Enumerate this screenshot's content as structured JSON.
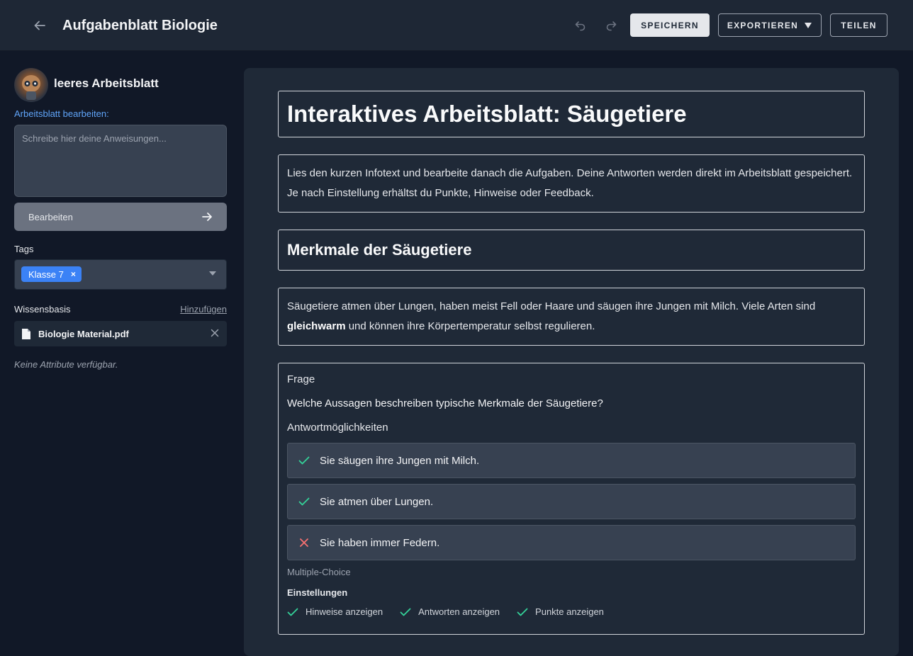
{
  "header": {
    "title": "Aufgabenblatt Biologie",
    "save_label": "SPEICHERN",
    "export_label": "EXPORTIEREN",
    "share_label": "TEILEN",
    "icons": [
      "arrow-left-icon",
      "undo-icon",
      "redo-icon",
      "caret-down-icon"
    ]
  },
  "sidebar": {
    "worksheet_name": "leeres Arbeitsblatt",
    "edit_label": "Arbeitsblatt bearbeiten:",
    "instructions_placeholder": "Schreibe hier deine Anweisungen...",
    "instructions_value": "",
    "edit_button_label": "Bearbeiten",
    "tags_label": "Tags",
    "tags": [
      "Klasse 7"
    ],
    "knowledge_label": "Wissensbasis",
    "knowledge_add": "Hinzufügen",
    "files": [
      {
        "name": "Biologie Material.pdf"
      }
    ],
    "no_attributes": "Keine Attribute verfügbar."
  },
  "worksheet": {
    "title": "Interaktives Arbeitsblatt: Säugetiere",
    "intro": "Lies den kurzen Infotext und bearbeite danach die Aufgaben. Deine Antworten werden direkt im Arbeitsblatt gespeichert. Je nach Einstellung erhältst du Punkte, Hinweise oder Feedback.",
    "section_title": "Merkmale der Säugetiere",
    "info_before": "Säugetiere atmen über Lungen, haben meist Fell oder Haare und säugen ihre Jungen mit Milch. Viele Arten sind ",
    "info_bold": "gleichwarm",
    "info_after": " und können ihre Körpertemperatur selbst regulieren.",
    "question": {
      "kicker": "Frage",
      "text": "Welche Aussagen beschreiben typische Merkmale der Säugetiere?",
      "options_label": "Antwortmöglichkeiten",
      "options": [
        {
          "text": "Sie säugen ihre Jungen mit Milch.",
          "correct": true
        },
        {
          "text": "Sie atmen über Lungen.",
          "correct": true
        },
        {
          "text": "Sie haben immer Federn.",
          "correct": false
        }
      ],
      "type": "Multiple-Choice",
      "settings_label": "Einstellungen",
      "settings": [
        "Hinweise anzeigen",
        "Antworten anzeigen",
        "Punkte anzeigen"
      ]
    }
  },
  "colors": {
    "accent_blue": "#3b82f6",
    "correct_green": "#34d399",
    "wrong_red": "#f87171"
  }
}
